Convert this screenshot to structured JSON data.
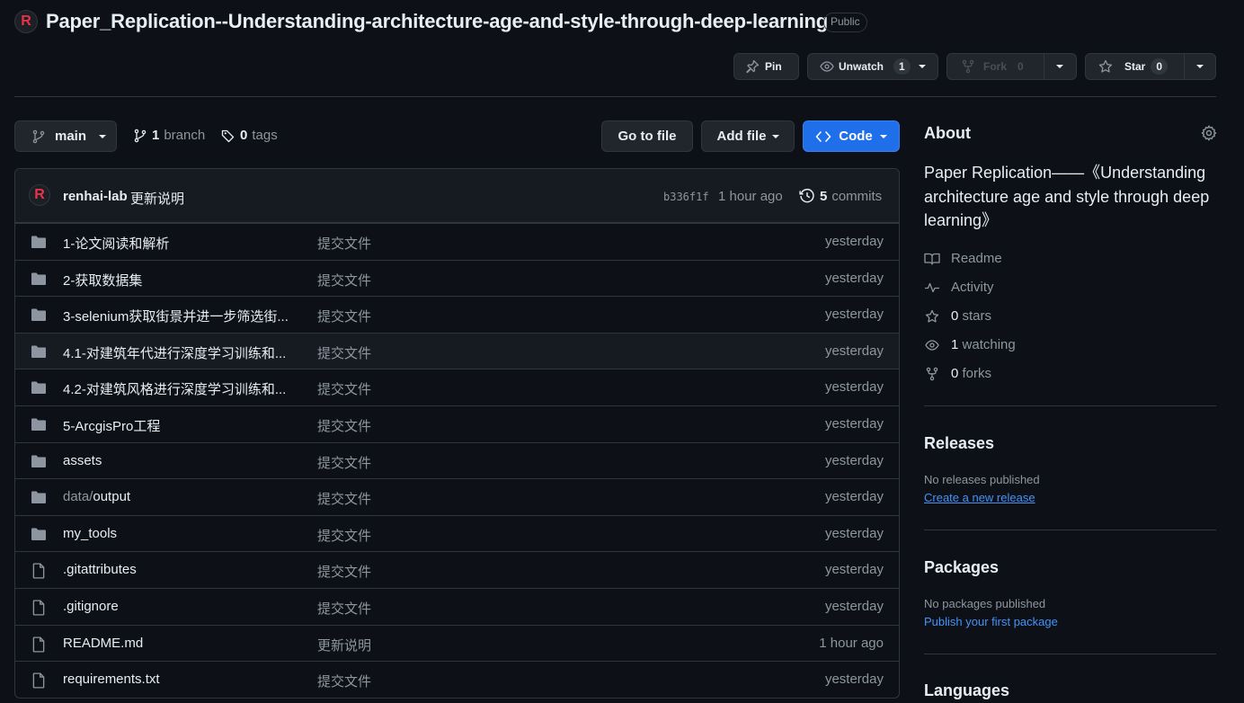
{
  "repo": {
    "name": "Paper_Replication--Understanding-architecture-age-and-style-through-deep-learning",
    "visibility": "Public",
    "avatar_letter": "R"
  },
  "actions": {
    "pin": "Pin",
    "unwatch": "Unwatch",
    "watch_count": "1",
    "fork": "Fork",
    "fork_count": "0",
    "star": "Star",
    "star_count": "0"
  },
  "toolbar": {
    "branch": "main",
    "branch_count": "1",
    "branch_label": "branch",
    "tag_count": "0",
    "tag_label": "tags",
    "go_to_file": "Go to file",
    "add_file": "Add file",
    "code": "Code"
  },
  "latest_commit": {
    "author": "renhai-lab",
    "message": "更新说明",
    "sha": "b336f1f",
    "time": "1 hour ago",
    "count": "5",
    "count_label": "commits"
  },
  "files": [
    {
      "type": "folder",
      "name": "1-论文阅读和解析",
      "message": "提交文件",
      "date": "yesterday"
    },
    {
      "type": "folder",
      "name": "2-获取数据集",
      "message": "提交文件",
      "date": "yesterday"
    },
    {
      "type": "folder",
      "name": "3-selenium获取街景并进一步筛选街...",
      "message": "提交文件",
      "date": "yesterday"
    },
    {
      "type": "folder",
      "name": "4.1-对建筑年代进行深度学习训练和...",
      "message": "提交文件",
      "date": "yesterday"
    },
    {
      "type": "folder",
      "name": "4.2-对建筑风格进行深度学习训练和...",
      "message": "提交文件",
      "date": "yesterday"
    },
    {
      "type": "folder",
      "name": "5-ArcgisPro工程",
      "message": "提交文件",
      "date": "yesterday"
    },
    {
      "type": "folder",
      "name": "assets",
      "message": "提交文件",
      "date": "yesterday"
    },
    {
      "type": "folder",
      "name_prefix": "data/",
      "name": "output",
      "message": "提交文件",
      "date": "yesterday"
    },
    {
      "type": "folder",
      "name": "my_tools",
      "message": "提交文件",
      "date": "yesterday"
    },
    {
      "type": "file",
      "name": ".gitattributes",
      "message": "提交文件",
      "date": "yesterday"
    },
    {
      "type": "file",
      "name": ".gitignore",
      "message": "提交文件",
      "date": "yesterday"
    },
    {
      "type": "file",
      "name": "README.md",
      "message": "更新说明",
      "date": "1 hour ago"
    },
    {
      "type": "file",
      "name": "requirements.txt",
      "message": "提交文件",
      "date": "yesterday"
    }
  ],
  "about": {
    "heading": "About",
    "description": "Paper Replication——《Understanding architecture age and style through deep learning》",
    "readme": "Readme",
    "activity": "Activity",
    "stars_count": "0",
    "stars_label": "stars",
    "watching_count": "1",
    "watching_label": "watching",
    "forks_count": "0",
    "forks_label": "forks"
  },
  "releases": {
    "heading": "Releases",
    "note": "No releases published",
    "link": "Create a new release"
  },
  "packages": {
    "heading": "Packages",
    "note": "No packages published",
    "link": "Publish your first package"
  },
  "languages": {
    "heading": "Languages"
  },
  "colors": {
    "background": "#0d1117",
    "border": "#30363d",
    "code_button": "#1f6feb",
    "link": "#4493f8",
    "avatar_letter": "#e8334a"
  }
}
